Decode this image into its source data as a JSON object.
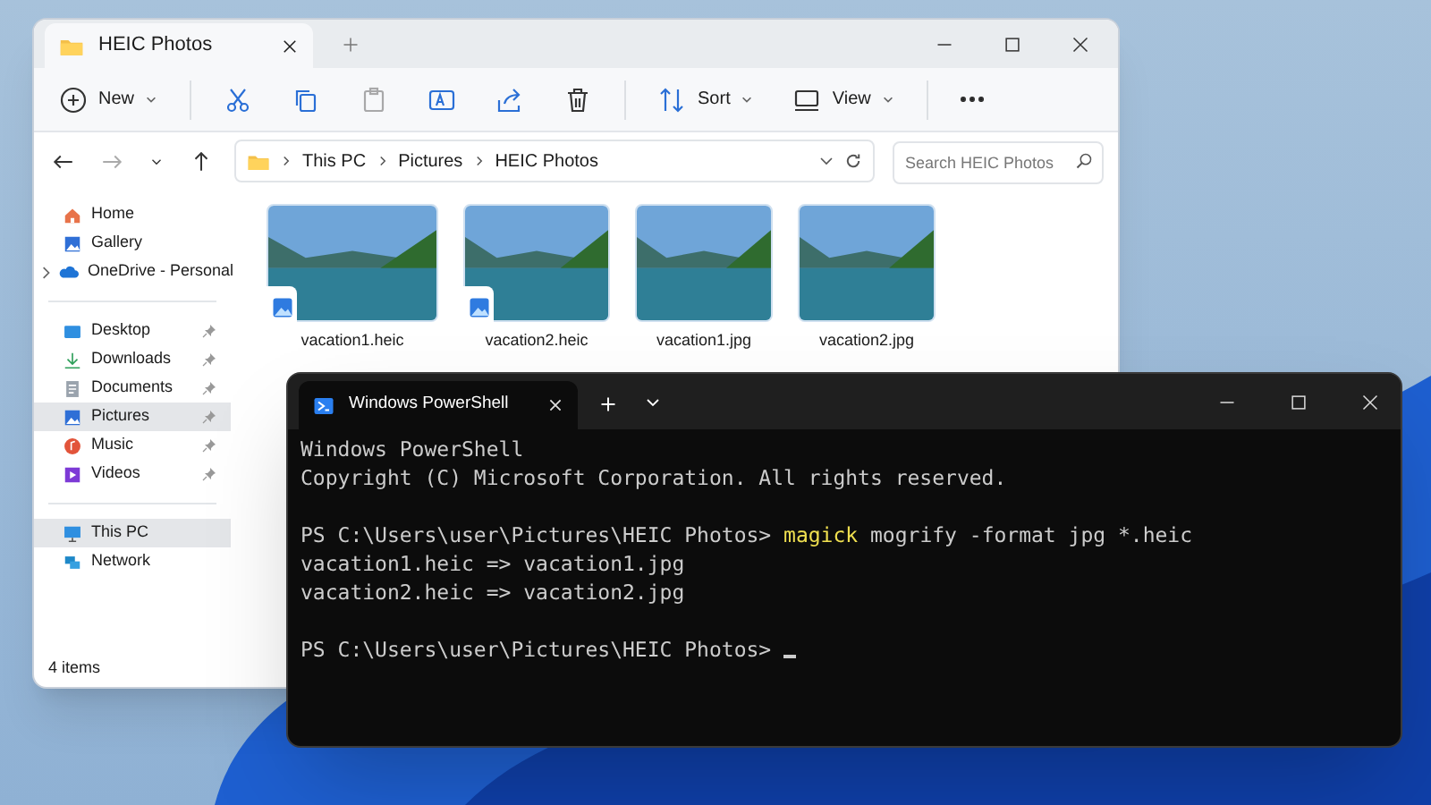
{
  "explorer": {
    "tab": {
      "title": "HEIC Photos"
    },
    "toolbar": [
      {
        "kind": "new",
        "label": "New",
        "disabled": false
      },
      {
        "kind": "cut",
        "disabled": false
      },
      {
        "kind": "copy",
        "disabled": false
      },
      {
        "kind": "paste",
        "disabled": true
      },
      {
        "kind": "rename",
        "disabled": false
      },
      {
        "kind": "share",
        "disabled": false
      },
      {
        "kind": "delete",
        "disabled": false
      },
      {
        "kind": "sort",
        "label": "Sort",
        "disabled": false
      },
      {
        "kind": "view",
        "label": "View",
        "disabled": false
      },
      {
        "kind": "more",
        "disabled": false
      }
    ],
    "breadcrumb": [
      "This PC",
      "Pictures",
      "HEIC Photos"
    ],
    "search": {
      "placeholder": "Search HEIC Photos"
    },
    "sidebar": [
      [
        {
          "kind": "home",
          "label": "Home",
          "selected": false,
          "pinned": false,
          "expandable": false
        },
        {
          "kind": "gallery",
          "label": "Gallery",
          "selected": false,
          "pinned": false,
          "expandable": false
        },
        {
          "kind": "cloud",
          "label": "OneDrive - Personal",
          "selected": false,
          "pinned": false,
          "expandable": true
        }
      ],
      [
        {
          "kind": "desktop",
          "label": "Desktop",
          "selected": false,
          "pinned": true,
          "expandable": false
        },
        {
          "kind": "downloads",
          "label": "Downloads",
          "selected": false,
          "pinned": true,
          "expandable": false
        },
        {
          "kind": "documents",
          "label": "Documents",
          "selected": false,
          "pinned": true,
          "expandable": false
        },
        {
          "kind": "pictures",
          "label": "Pictures",
          "selected": true,
          "pinned": true,
          "expandable": false
        },
        {
          "kind": "music",
          "label": "Music",
          "selected": false,
          "pinned": true,
          "expandable": false
        },
        {
          "kind": "videos",
          "label": "Videos",
          "selected": false,
          "pinned": true,
          "expandable": false
        }
      ],
      [
        {
          "kind": "pc",
          "label": "This PC",
          "selected": true,
          "pinned": false,
          "expandable": false
        },
        {
          "kind": "network",
          "label": "Network",
          "selected": false,
          "pinned": false,
          "expandable": false
        }
      ]
    ],
    "files": [
      {
        "name": "vacation1.heic",
        "badge": true
      },
      {
        "name": "vacation2.heic",
        "badge": true
      },
      {
        "name": "vacation1.jpg",
        "badge": false
      },
      {
        "name": "vacation2.jpg",
        "badge": false
      }
    ],
    "status_bar": "4 items"
  },
  "terminal": {
    "tab": {
      "title": "Windows PowerShell"
    },
    "blocks": [
      [
        {
          "segments": [
            {
              "kind": "output",
              "text": "Windows PowerShell"
            }
          ]
        },
        {
          "segments": [
            {
              "kind": "output",
              "text": "Copyright (C) Microsoft Corporation. All rights reserved."
            }
          ]
        }
      ],
      [
        {
          "segments": [
            {
              "kind": "prompt",
              "text": "PS C:\\Users\\user\\Pictures\\HEIC Photos> "
            },
            {
              "kind": "command",
              "text": "magick"
            },
            {
              "kind": "output",
              "text": " mogrify -format jpg *.heic"
            }
          ]
        },
        {
          "segments": [
            {
              "kind": "output",
              "text": "vacation1.heic => vacation1.jpg"
            }
          ]
        },
        {
          "segments": [
            {
              "kind": "output",
              "text": "vacation2.heic => vacation2.jpg"
            }
          ]
        }
      ],
      [
        {
          "segments": [
            {
              "kind": "prompt",
              "text": "PS C:\\Users\\user\\Pictures\\HEIC Photos> "
            }
          ],
          "cursor": true
        }
      ]
    ]
  }
}
